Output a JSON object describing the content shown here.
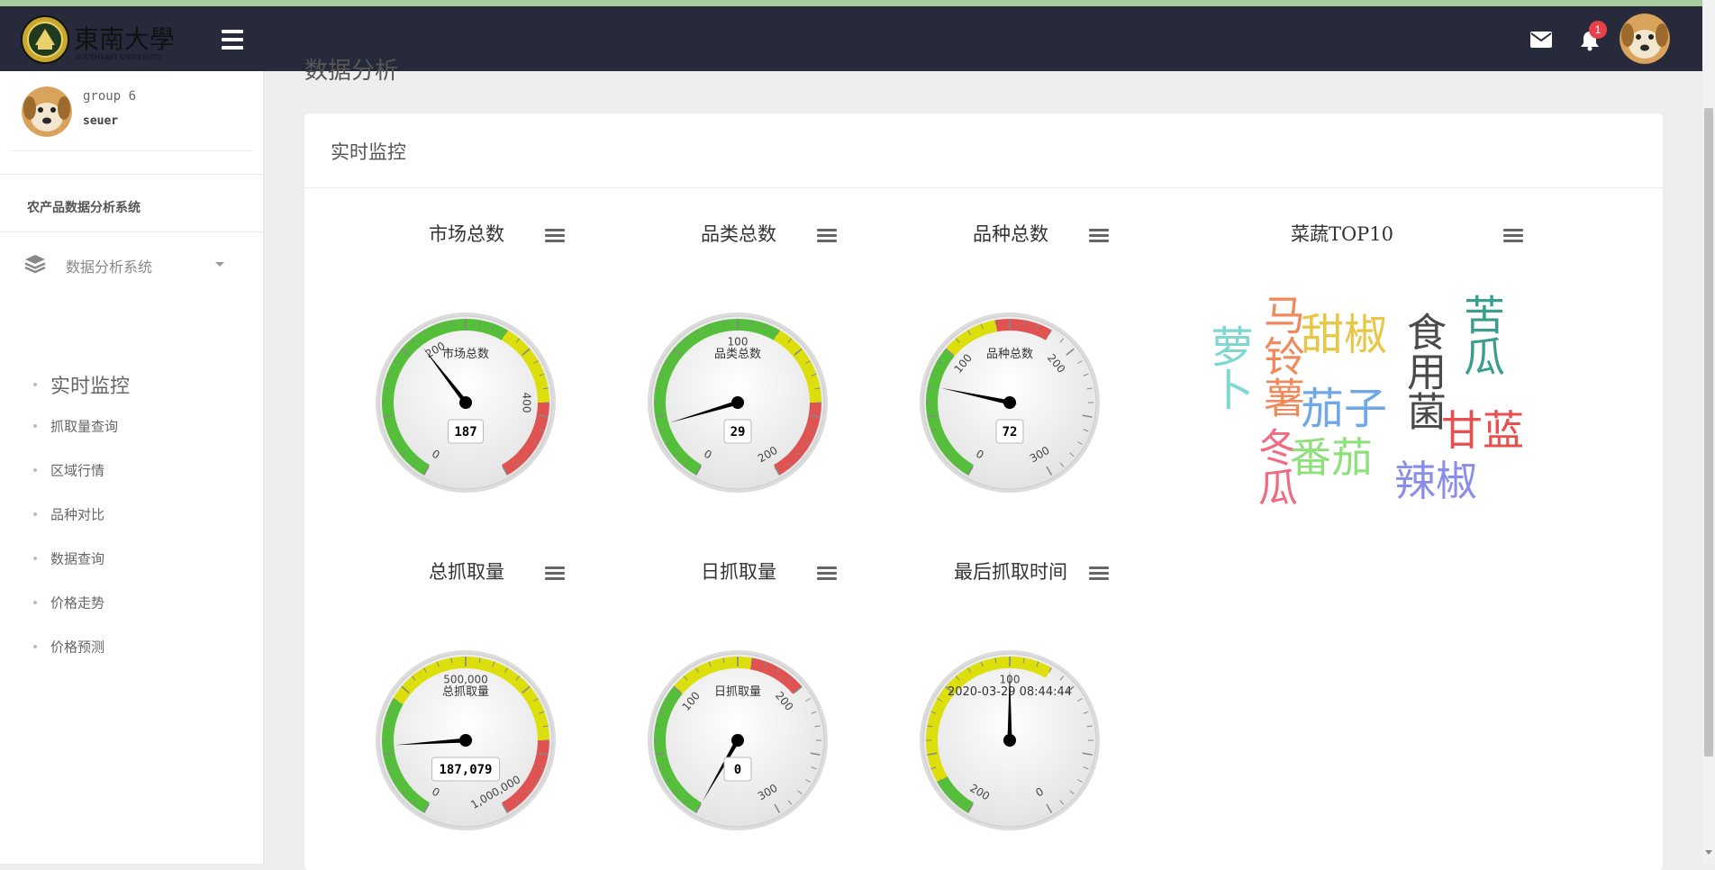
{
  "header": {
    "logo_text": "東南大學",
    "logo_subtext": "SOUTHEAST UNIVERSITY",
    "notification_count": "1"
  },
  "user": {
    "name": "group 6",
    "role": "seuer"
  },
  "sidebar": {
    "system_title": "农产品数据分析系统",
    "group_label": "数据分析系统",
    "items": [
      {
        "label": "实时监控"
      },
      {
        "label": "抓取量查询"
      },
      {
        "label": "区域行情"
      },
      {
        "label": "品种对比"
      },
      {
        "label": "数据查询"
      },
      {
        "label": "价格走势"
      },
      {
        "label": "价格预测"
      }
    ]
  },
  "page": {
    "title": "数据分析",
    "card_title": "实时监控"
  },
  "gauges": [
    {
      "title": "市场总数",
      "inner_label": "市场总数",
      "value": 187,
      "value_text": "187",
      "min": 0,
      "max": 500,
      "bands": [
        [
          0,
          300,
          "#55bf3b"
        ],
        [
          300,
          400,
          "#dddf0d"
        ],
        [
          400,
          500,
          "#df5353"
        ]
      ],
      "tick_labels": [
        [
          0,
          "0"
        ],
        [
          200,
          "200"
        ],
        [
          400,
          "400"
        ]
      ]
    },
    {
      "title": "品类总数",
      "inner_label": "品类总数",
      "value": 29,
      "value_text": "29",
      "min": 0,
      "max": 200,
      "bands": [
        [
          0,
          120,
          "#55bf3b"
        ],
        [
          120,
          160,
          "#dddf0d"
        ],
        [
          160,
          200,
          "#df5353"
        ]
      ],
      "tick_labels": [
        [
          0,
          "0"
        ],
        [
          100,
          "100"
        ],
        [
          200,
          "200"
        ]
      ]
    },
    {
      "title": "品种总数",
      "inner_label": "品种总数",
      "value": 72,
      "value_text": "72",
      "min": 0,
      "max": 300,
      "bands": [
        [
          0,
          100,
          "#55bf3b"
        ],
        [
          100,
          140,
          "#dddf0d"
        ],
        [
          140,
          180,
          "#df5353"
        ]
      ],
      "tick_labels": [
        [
          0,
          "0"
        ],
        [
          100,
          "100"
        ],
        [
          200,
          "200"
        ],
        [
          300,
          "300"
        ]
      ]
    },
    {
      "title": "总抓取量",
      "inner_label": "总抓取量",
      "value": 187079,
      "value_text": "187,079",
      "min": 0,
      "max": 1000000,
      "bands": [
        [
          0,
          300000,
          "#55bf3b"
        ],
        [
          300000,
          800000,
          "#dddf0d"
        ],
        [
          800000,
          1000000,
          "#df5353"
        ]
      ],
      "tick_labels": [
        [
          0,
          "0"
        ],
        [
          500000,
          "500,000"
        ],
        [
          1000000,
          "1,000,000"
        ]
      ]
    },
    {
      "title": "日抓取量",
      "inner_label": "日抓取量",
      "value": 0,
      "value_text": "0",
      "min": 0,
      "max": 300,
      "bands": [
        [
          0,
          100,
          "#55bf3b"
        ],
        [
          100,
          160,
          "#dddf0d"
        ],
        [
          160,
          200,
          "#df5353"
        ]
      ],
      "tick_labels": [
        [
          100,
          "100"
        ],
        [
          200,
          "200"
        ],
        [
          300,
          "300"
        ]
      ]
    },
    {
      "title": "最后抓取时间",
      "inner_label": "2020-03-29 08:44:44",
      "value": 100,
      "value_text": "",
      "min": 200,
      "max": 0,
      "bands": [
        [
          200,
          180,
          "#55bf3b"
        ],
        [
          180,
          80,
          "#dddf0d"
        ]
      ],
      "tick_labels": [
        [
          200,
          "200"
        ],
        [
          100,
          "100"
        ],
        [
          0,
          "0"
        ]
      ]
    }
  ],
  "wordcloud": {
    "title": "菜蔬TOP10",
    "words": [
      {
        "text": "萝卜",
        "color": "#7fd8d0"
      },
      {
        "text": "马铃薯",
        "color": "#f08a5d"
      },
      {
        "text": "冬瓜",
        "color": "#f06b82"
      },
      {
        "text": "甜椒",
        "color": "#e8c646"
      },
      {
        "text": "茄子",
        "color": "#6fa8e8"
      },
      {
        "text": "番茄",
        "color": "#8ee07a"
      },
      {
        "text": "食用菌",
        "color": "#4a4a4a"
      },
      {
        "text": "苦瓜",
        "color": "#3a9e8e"
      },
      {
        "text": "甘蓝",
        "color": "#e85050"
      },
      {
        "text": "辣椒",
        "color": "#8b8ee8"
      }
    ]
  }
}
